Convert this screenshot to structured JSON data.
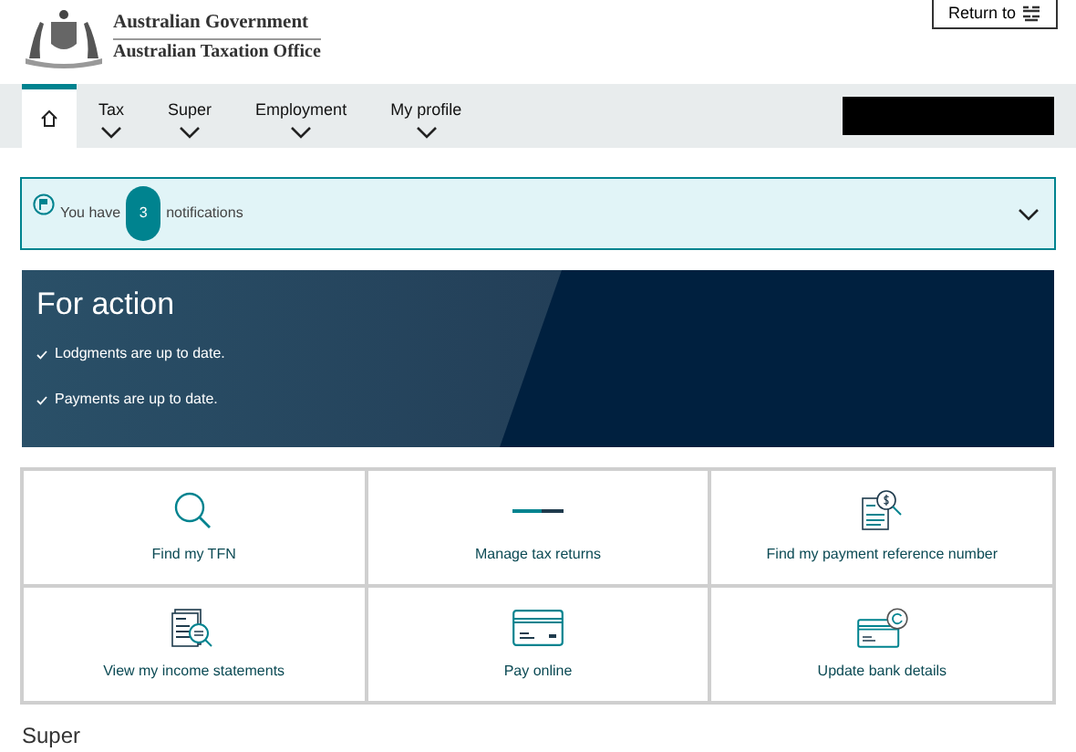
{
  "header": {
    "agency_lines": [
      "Australian Government",
      "Australian Taxation Office"
    ],
    "return_button": "Return to"
  },
  "nav": {
    "items": [
      {
        "kind": "home",
        "selected": true
      },
      {
        "kind": "menu",
        "label": "Tax",
        "selected": false
      },
      {
        "kind": "menu",
        "label": "Super",
        "selected": false
      },
      {
        "kind": "menu",
        "label": "Employment",
        "selected": false
      },
      {
        "kind": "menu",
        "label": "My profile",
        "selected": false
      }
    ]
  },
  "notifications": {
    "before": "You have",
    "count": "3",
    "after": "notifications",
    "expanded": false
  },
  "for_action": {
    "title": "For action",
    "items": [
      "Lodgments are up to date.",
      "Payments are up to date."
    ]
  },
  "tiles": [
    {
      "kind": "search",
      "label": "Find my TFN"
    },
    {
      "kind": "loading",
      "label": "Manage tax returns"
    },
    {
      "kind": "payment-ref",
      "label": "Find my payment reference number"
    },
    {
      "kind": "statements",
      "label": "View my income statements"
    },
    {
      "kind": "card",
      "label": "Pay online"
    },
    {
      "kind": "bank",
      "label": "Update bank details"
    }
  ],
  "section_heading": "Super"
}
